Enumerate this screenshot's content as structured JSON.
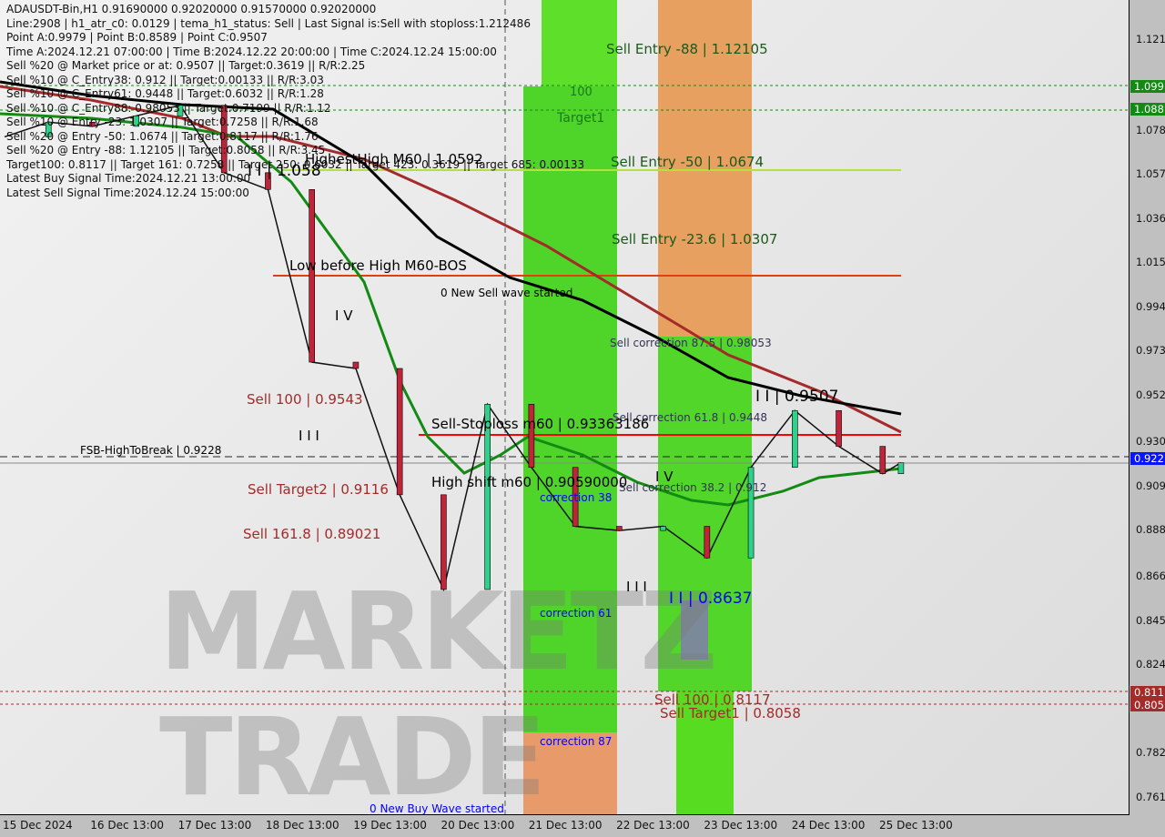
{
  "header": {
    "lines": [
      "ADAUSDT-Bin,H1  0.91690000 0.92020000 0.91570000 0.92020000",
      "Line:2908 | h1_atr_c0: 0.0129 | tema_h1_status: Sell | Last Signal is:Sell with stoploss:1.212486",
      "Point A:0.9979 | Point B:0.8589 | Point C:0.9507",
      "Time A:2024.12.21 07:00:00 | Time B:2024.12.22 20:00:00 | Time C:2024.12.24 15:00:00",
      "Sell %20 @ Market price or at: 0.9507 || Target:0.3619 || R/R:2.25",
      "Sell %10 @ C_Entry38: 0.912 || Target:0.00133 || R/R:3.03",
      "Sell %10 @ C_Entry61: 0.9448 || Target:0.6032 || R/R:1.28",
      "Sell %10 @ C_Entry88: 0.98053 || Target:0.7199 || R/R:1.12",
      "Sell %10 @ Entry -23: 1.0307 || Target:0.7258 || R/R:1.68",
      "Sell %20 @ Entry -50: 1.0674 || Target:0.8117 || R/R:1.76",
      "Sell %20 @ Entry -88: 1.12105 || Target:0.8058 || R/R:3.45",
      "Target100: 0.8117 || Target 161: 0.7258 || Target 250: 0.6032 || Target 423: 0.3619 || Target 685: 0.00133",
      "Latest Buy Signal Time:2024.12.21 13:00:00",
      "Latest Sell Signal Time:2024.12.24 15:00:00"
    ]
  },
  "annotations": {
    "sell_entry_88": "Sell Entry -88 | 1.12105",
    "z100": "100",
    "target1": "Target1",
    "highest_high": "HighestHigh   M60 | 1.0592",
    "ii_1058": "I I | 1.058",
    "sell_entry_50": "Sell Entry -50 | 1.0674",
    "sell_entry_23": "Sell Entry -23.6 | 1.0307",
    "low_before_high": "Low before High   M60-BOS",
    "new_sell_wave": "0 New Sell wave started",
    "iv_1": "I V",
    "sell_corr_875": "Sell correction 87.5 | 0.98053",
    "sell_100": "Sell 100 | 0.9543",
    "ii_9507": "I I | 0.9507",
    "sell_corr_618": "Sell correction 61.8 | 0.9448",
    "sell_stoploss": "Sell-Stoploss m60 | 0.93363186",
    "iii": "I I I",
    "fsb": "FSB-HighToBreak | 0.9228",
    "high_shift": "High shift m60 | 0.90590000",
    "iv_2": "I V",
    "sell_corr_382": "Sell correction 38.2 | 0.912",
    "corr_38": "correction 38",
    "sell_target2": "Sell Target2 | 0.9116",
    "sell_1618": "Sell 161.8 | 0.89021",
    "iii_2": "I I I",
    "ii_8637": "I I | 0.8637",
    "corr_61": "correction 61",
    "sell_100b": "Sell 100 | 0.8117",
    "sell_target1": "Sell Target1 | 0.8058",
    "corr_87": "correction 87",
    "new_buy_wave": "0 New Buy Wave started"
  },
  "watermark": "MARKETZ TRADE",
  "y_axis": {
    "ticks": [
      "1.121",
      "1.078",
      "1.057",
      "1.036",
      "1.015",
      "0.994",
      "0.973",
      "0.952",
      "0.930",
      "0.909",
      "0.888",
      "0.866",
      "0.845",
      "0.824",
      "0.782",
      "0.761"
    ],
    "badges": [
      {
        "text": "1.099",
        "color": "#138a13"
      },
      {
        "text": "1.088",
        "color": "#138a13"
      },
      {
        "text": "0.922",
        "color": "#0a14ff"
      },
      {
        "text": "0.811",
        "color": "#a52a2a"
      },
      {
        "text": "0.805",
        "color": "#a52a2a"
      }
    ]
  },
  "x_axis": {
    "ticks": [
      "15 Dec 2024",
      "16 Dec 13:00",
      "17 Dec 13:00",
      "18 Dec 13:00",
      "19 Dec 13:00",
      "20 Dec 13:00",
      "21 Dec 13:00",
      "22 Dec 13:00",
      "23 Dec 13:00",
      "24 Dec 13:00",
      "25 Dec 13:00"
    ]
  },
  "chart_data": {
    "type": "line",
    "title": "ADAUSDT-Bin,H1",
    "ylim": [
      0.761,
      1.121
    ],
    "grid": false,
    "x": [
      "2024-12-15 13:00",
      "2024-12-16 01:00",
      "2024-12-16 13:00",
      "2024-12-17 01:00",
      "2024-12-17 13:00",
      "2024-12-18 01:00",
      "2024-12-18 13:00",
      "2024-12-19 01:00",
      "2024-12-19 13:00",
      "2024-12-20 01:00",
      "2024-12-20 13:00",
      "2024-12-21 01:00",
      "2024-12-21 13:00",
      "2024-12-22 01:00",
      "2024-12-22 13:00",
      "2024-12-23 01:00",
      "2024-12-23 13:00",
      "2024-12-24 01:00",
      "2024-12-24 13:00",
      "2024-12-25 01:00",
      "2024-12-25 13:00",
      "2024-12-25 18:00"
    ],
    "series": [
      {
        "values": [
          1.075,
          1.082,
          1.08,
          1.085,
          1.09,
          1.058,
          1.05,
          0.968,
          0.965,
          0.905,
          0.86,
          0.948,
          0.918,
          0.89,
          0.888,
          0.89,
          0.875,
          0.918,
          0.945,
          0.928,
          0.915,
          0.9202
        ]
      }
    ],
    "levels": {
      "sell_stoploss": 0.93363186,
      "fsb_high_to_break": 0.9228,
      "highest_high": 1.0592,
      "low_before_high": 1.0154,
      "current": 0.9202
    }
  }
}
